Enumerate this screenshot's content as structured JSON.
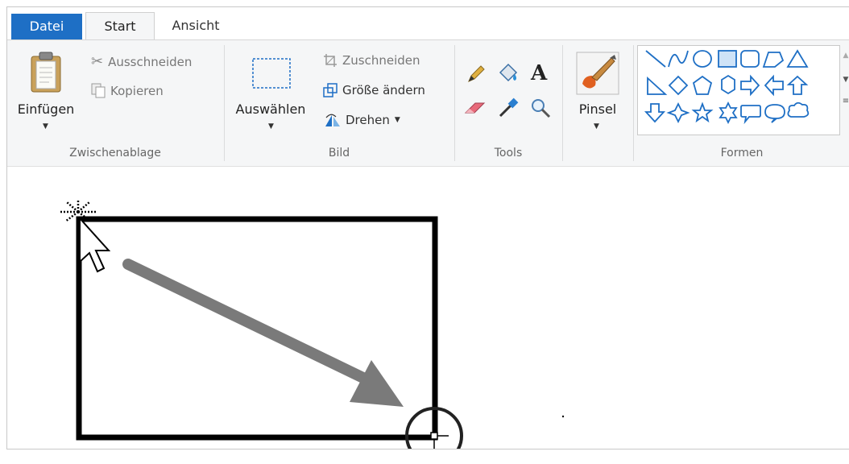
{
  "tabs": {
    "file": "Datei",
    "start": "Start",
    "view": "Ansicht"
  },
  "clipboard": {
    "paste": "Einfügen",
    "cut": "Ausschneiden",
    "copy": "Kopieren",
    "label": "Zwischenablage"
  },
  "image": {
    "select": "Auswählen",
    "crop": "Zuschneiden",
    "resize": "Größe ändern",
    "rotate": "Drehen",
    "label": "Bild"
  },
  "tools": {
    "label": "Tools",
    "text_glyph": "A"
  },
  "brushes": {
    "label": "Pinsel"
  },
  "shapes": {
    "label": "Formen"
  },
  "colors": {
    "accent": "#1e6fc5",
    "ribbon_bg": "#f5f6f7",
    "arrow": "#7a7a7a"
  }
}
